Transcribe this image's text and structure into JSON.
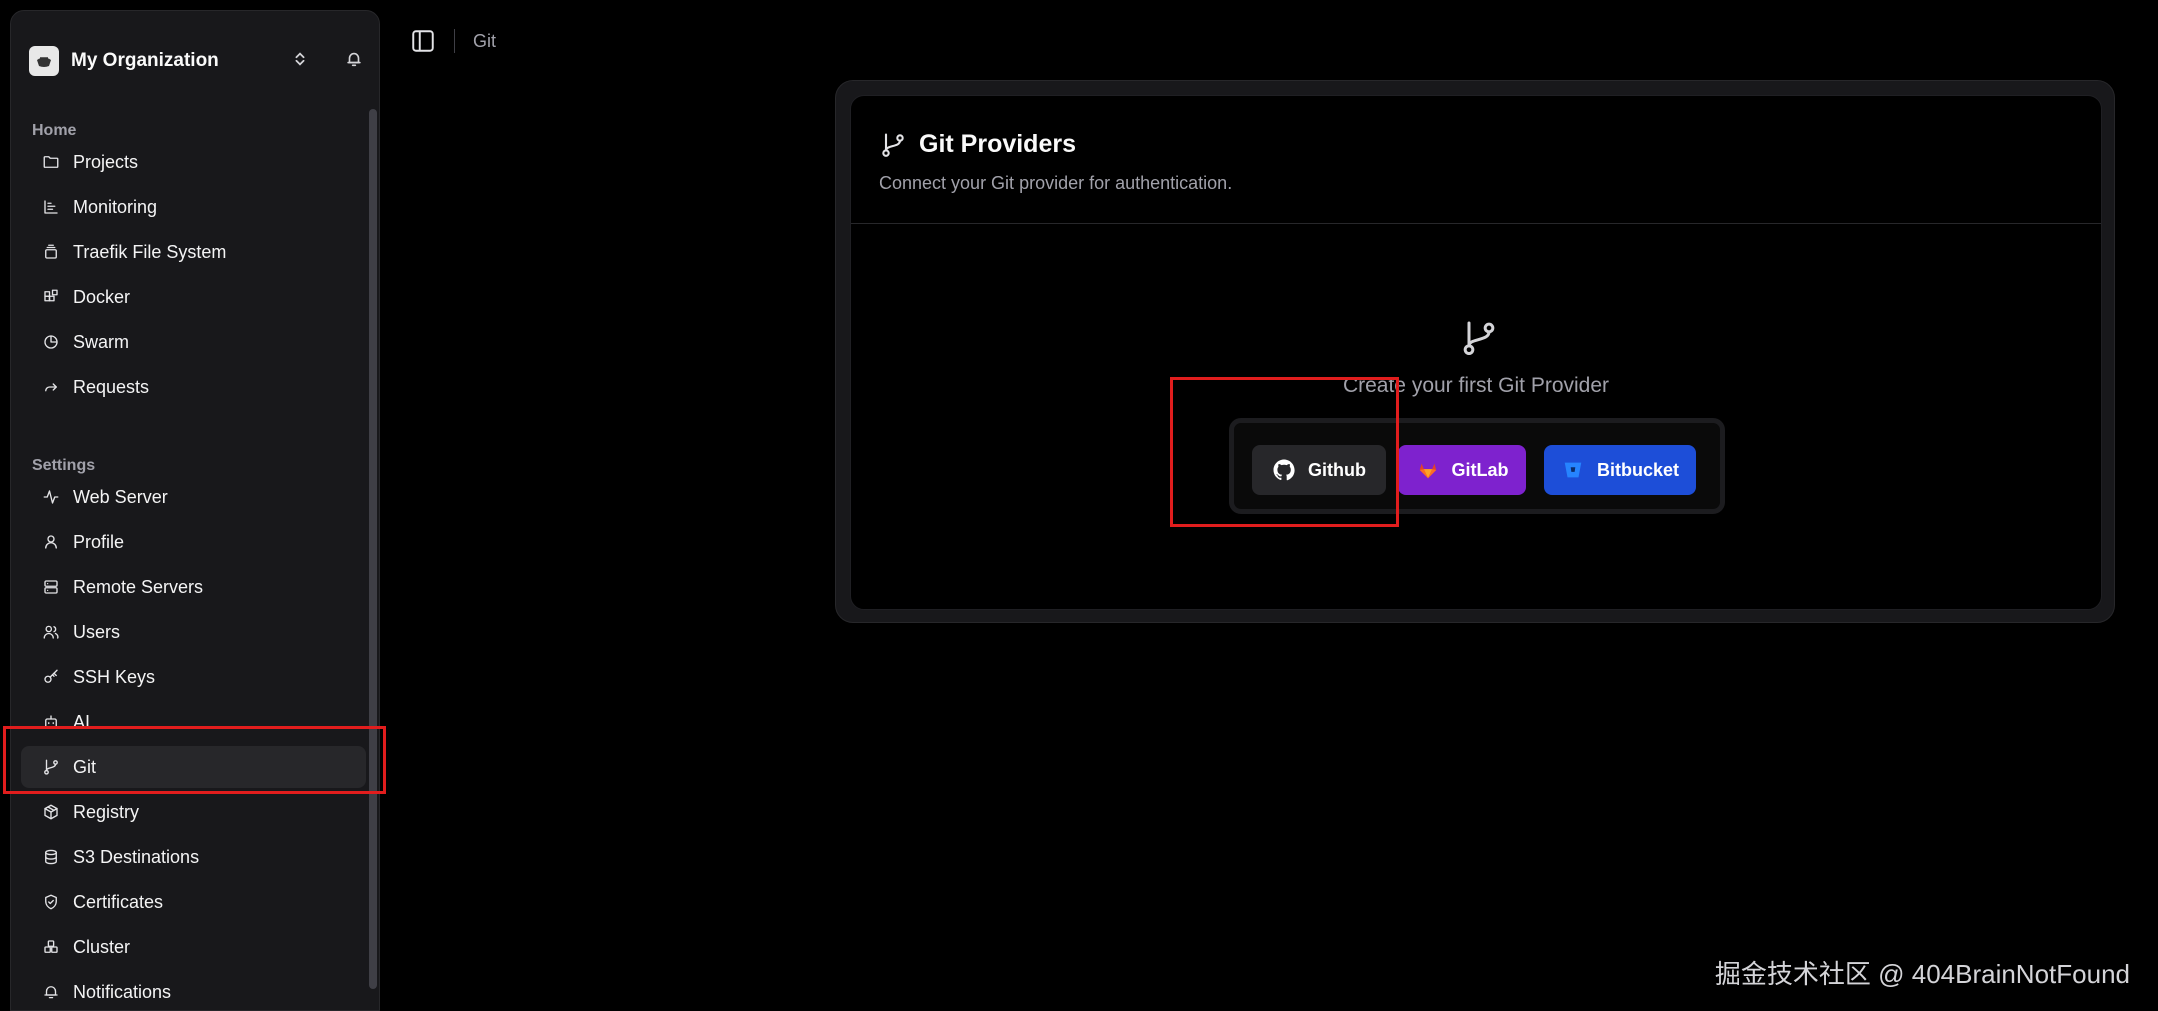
{
  "org": {
    "name": "My Organization"
  },
  "sidebar": {
    "home_label": "Home",
    "settings_label": "Settings",
    "home_items": [
      {
        "label": "Projects",
        "icon": "folder-icon"
      },
      {
        "label": "Monitoring",
        "icon": "chart-icon"
      },
      {
        "label": "Traefik File System",
        "icon": "file-stack-icon"
      },
      {
        "label": "Docker",
        "icon": "blocks-icon"
      },
      {
        "label": "Swarm",
        "icon": "pie-icon"
      },
      {
        "label": "Requests",
        "icon": "forward-arrow-icon"
      }
    ],
    "settings_items": [
      {
        "label": "Web Server",
        "icon": "activity-icon"
      },
      {
        "label": "Profile",
        "icon": "user-icon"
      },
      {
        "label": "Remote Servers",
        "icon": "server-icon"
      },
      {
        "label": "Users",
        "icon": "users-icon"
      },
      {
        "label": "SSH Keys",
        "icon": "key-icon"
      },
      {
        "label": "AI",
        "icon": "bot-icon"
      },
      {
        "label": "Git",
        "icon": "git-branch-icon",
        "active": true
      },
      {
        "label": "Registry",
        "icon": "package-icon"
      },
      {
        "label": "S3 Destinations",
        "icon": "database-icon"
      },
      {
        "label": "Certificates",
        "icon": "shield-check-icon"
      },
      {
        "label": "Cluster",
        "icon": "boxes-icon"
      },
      {
        "label": "Notifications",
        "icon": "bell-icon"
      }
    ]
  },
  "breadcrumb": {
    "current": "Git"
  },
  "card": {
    "title": "Git Providers",
    "description": "Connect your Git provider for authentication.",
    "empty_text": "Create your first Git Provider"
  },
  "providers": {
    "github_label": "Github",
    "gitlab_label": "GitLab",
    "bitbucket_label": "Bitbucket",
    "github_color": "#27272a",
    "gitlab_color": "#7e22ce",
    "bitbucket_color": "#1d4ed8"
  },
  "watermark": "掘金技术社区 @ 404BrainNotFound",
  "highlight_color": "#e11d1d"
}
